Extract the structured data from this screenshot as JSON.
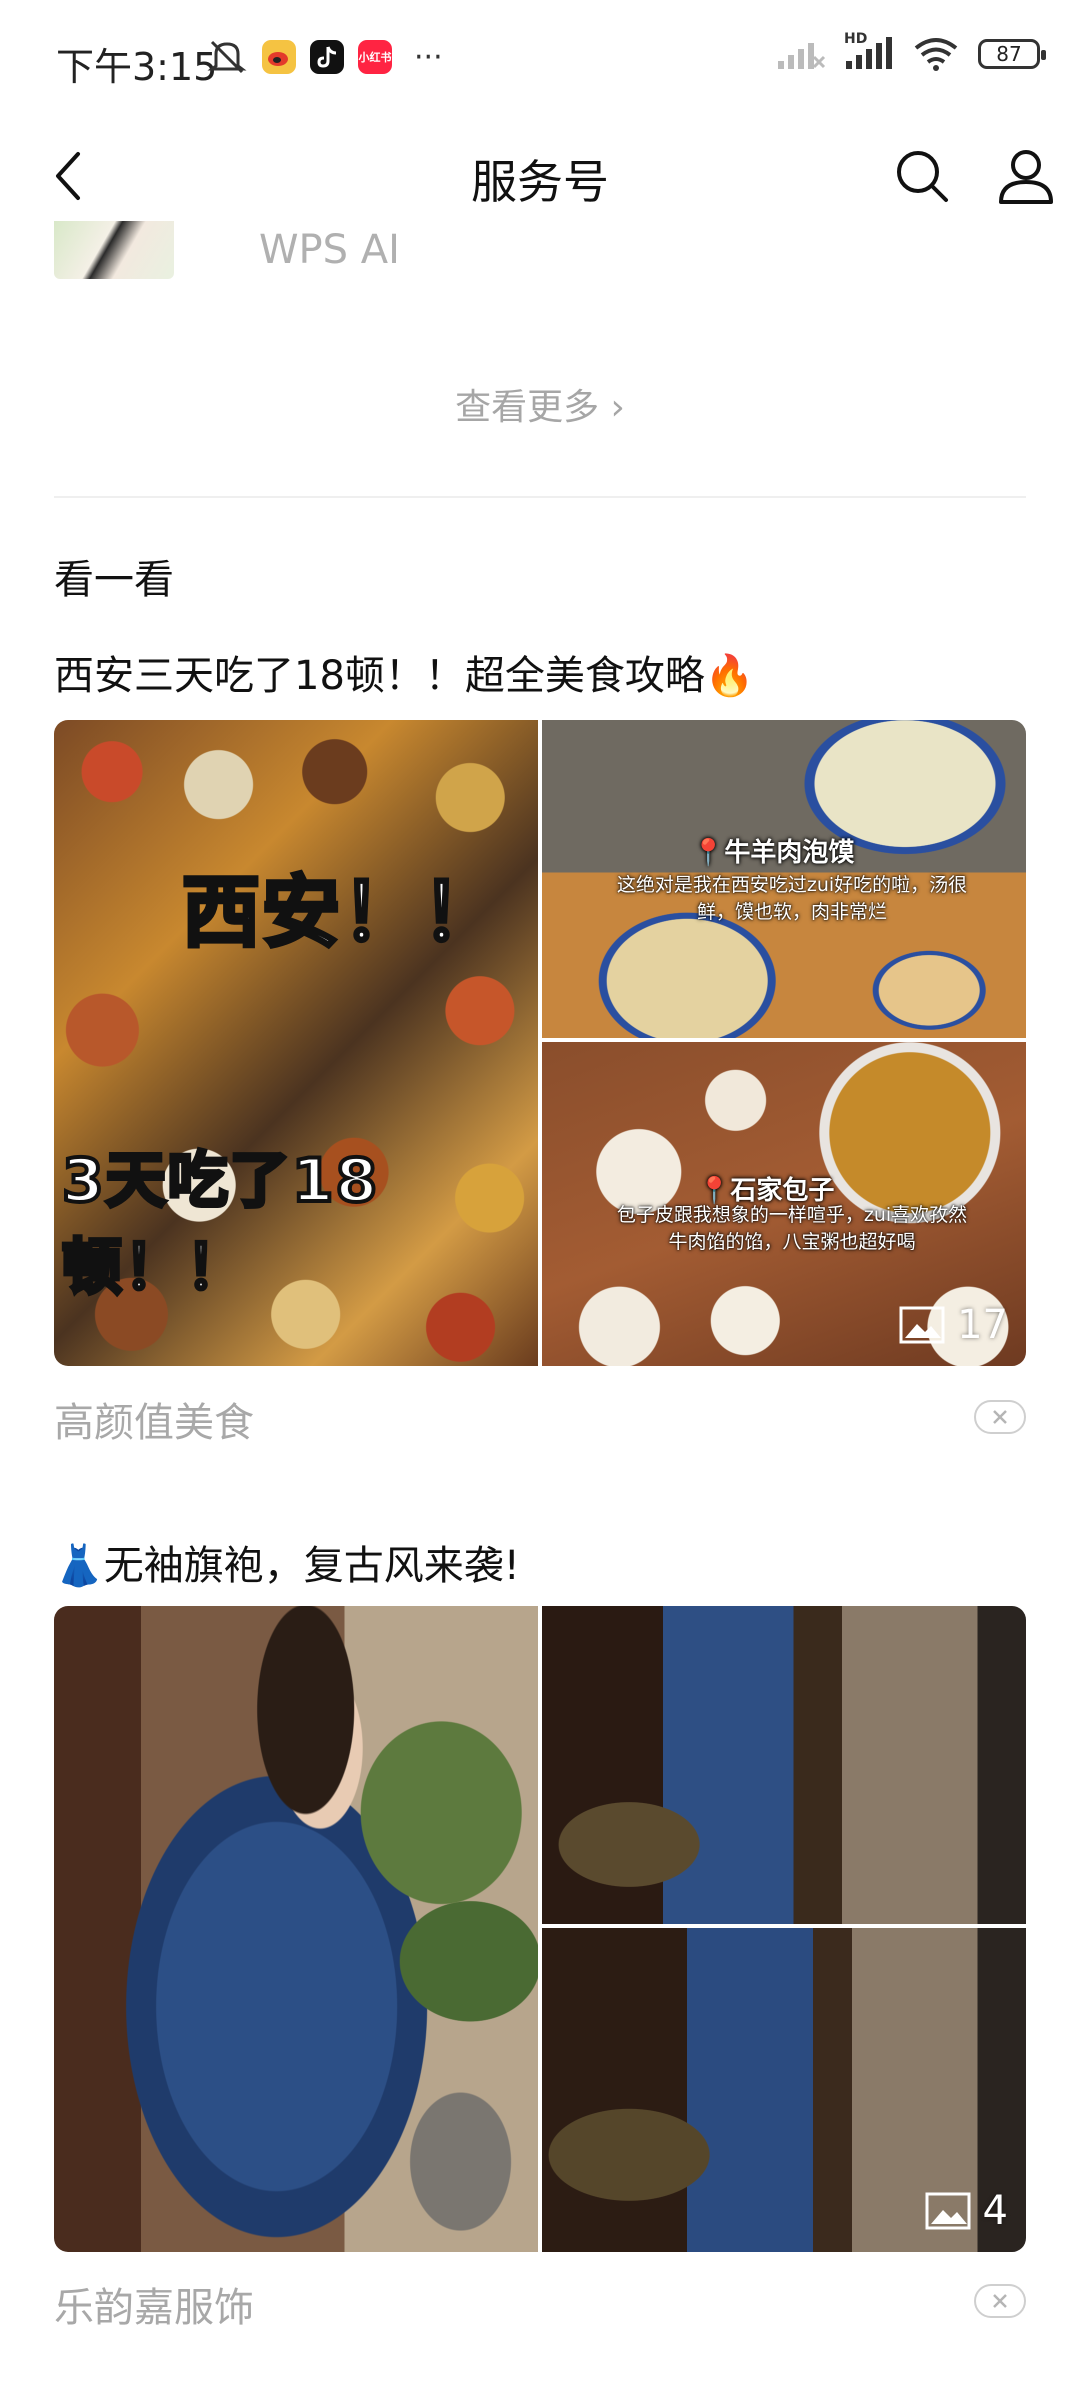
{
  "status_bar": {
    "time": "下午3:15",
    "battery": "87",
    "network_label": "HD",
    "more": "···",
    "app_icon_label": "小红书"
  },
  "header": {
    "title": "服务号"
  },
  "account": {
    "name": "WPS AI"
  },
  "view_more": "查看更多 ›",
  "section": {
    "title": "看一看"
  },
  "articles": [
    {
      "title": "西安三天吃了18顿！！超全美食攻略🔥",
      "image_count": "17",
      "source": "高颜值美食",
      "overlay_top": "西安！！",
      "overlay_bottom": "3天吃了18顿！！",
      "caption1_title": "📍牛羊肉泡馍",
      "caption1_text": "这绝对是我在西安吃过zui好吃的啦，汤很鲜，馍也软，肉非常烂",
      "caption2_title": "📍石家包子",
      "caption2_text": "包子皮跟我想象的一样喧乎，zui喜欢孜然牛肉馅的馅，八宝粥也超好喝"
    },
    {
      "title": "👗无袖旗袍，复古风来袭!",
      "image_count": "4",
      "source": "乐韵嘉服饰"
    }
  ],
  "icons": {
    "back": "chevron-left-icon",
    "search": "search-icon",
    "profile": "person-icon",
    "gallery": "image-icon",
    "dismiss": "close-icon"
  }
}
